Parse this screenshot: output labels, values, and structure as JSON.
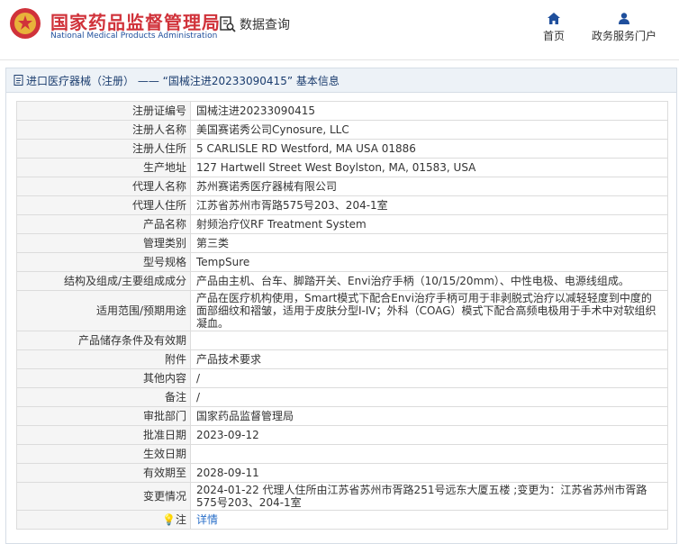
{
  "header": {
    "brand_cn": "国家药品监督管理局",
    "brand_en": "National Medical Products Administration",
    "query_label": "数据查询",
    "nav": [
      {
        "label": "首页",
        "icon": "home-icon"
      },
      {
        "label": "政务服务门户",
        "icon": "user-icon"
      }
    ]
  },
  "breadcrumb": {
    "text": "进口医疗器械（注册） —— “国械注进20233090415” 基本信息"
  },
  "rows": [
    {
      "k": "注册证编号",
      "v": "国械注进20233090415"
    },
    {
      "k": "注册人名称",
      "v": "美国赛诺秀公司Cynosure, LLC"
    },
    {
      "k": "注册人住所",
      "v": "5 CARLISLE RD Westford, MA USA 01886"
    },
    {
      "k": "生产地址",
      "v": "127 Hartwell Street West Boylston, MA, 01583, USA"
    },
    {
      "k": "代理人名称",
      "v": "苏州赛诺秀医疗器械有限公司"
    },
    {
      "k": "代理人住所",
      "v": "江苏省苏州市胥路575号203、204-1室"
    },
    {
      "k": "产品名称",
      "v": "射频治疗仪RF Treatment System"
    },
    {
      "k": "管理类别",
      "v": "第三类"
    },
    {
      "k": "型号规格",
      "v": "TempSure"
    },
    {
      "k": "结构及组成/主要组成成分",
      "v": "产品由主机、台车、脚踏开关、Envi治疗手柄（10/15/20mm）、中性电极、电源线组成。"
    },
    {
      "k": "适用范围/预期用途",
      "v": "产品在医疗机构使用，Smart模式下配合Envi治疗手柄可用于非剥脱式治疗以减轻轻度到中度的面部细纹和褶皱，适用于皮肤分型I-IV；外科（COAG）模式下配合高频电极用于手术中对软组织凝血。"
    },
    {
      "k": "产品储存条件及有效期",
      "v": ""
    },
    {
      "k": "附件",
      "v": "产品技术要求"
    },
    {
      "k": "其他内容",
      "v": "/"
    },
    {
      "k": "备注",
      "v": "/"
    },
    {
      "k": "审批部门",
      "v": "国家药品监督管理局"
    },
    {
      "k": "批准日期",
      "v": "2023-09-12"
    },
    {
      "k": "生效日期",
      "v": ""
    },
    {
      "k": "有效期至",
      "v": "2028-09-11"
    },
    {
      "k": "变更情况",
      "v": "2024-01-22 代理人住所由江苏省苏州市胥路251号远东大厦五楼 ;变更为：江苏省苏州市胥路575号203、204-1室"
    },
    {
      "k": "注",
      "v": "详情",
      "icon": "bulb-icon"
    }
  ]
}
